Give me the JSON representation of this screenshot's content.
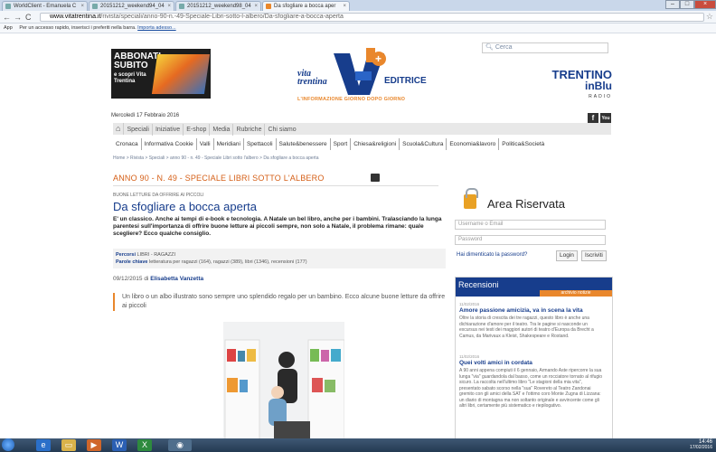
{
  "browser": {
    "tabs": [
      {
        "label": "WorldClient - Emanuela C"
      },
      {
        "label": "20151212_weekend94_04"
      },
      {
        "label": "20151212_weekend98_04"
      },
      {
        "label": "Da sfogliare a bocca aper"
      }
    ],
    "url_domain": "www.vitatrentina.it",
    "url_path": "/rivista/speciali/anno-90-n.-49-Speciale-Libri-sotto-l-albero/Da-sfogliare-a-bocca-aperta",
    "bookmarks_apps": "App",
    "bookmarks_text": "Per un accesso rapido, inserisci i preferiti nella barra.",
    "bookmarks_link": "Importa adesso..."
  },
  "header": {
    "abbonati_title": "ABBONATI SUBITO",
    "abbonati_sub": "e scopri Vita Trentina",
    "date": "Mercoledì 17 Febbraio 2016",
    "logo_vita": "vita trentina",
    "logo_editrice": "EDITRICE",
    "logo_tagline": "L'INFORMAZIONE GIORNO DOPO GIORNO",
    "search_placeholder": "Cerca",
    "radio_trentino": "TRENTINO",
    "radio_inblu": "inBlu",
    "radio_label": "RADIO",
    "social_fb": "f",
    "social_yt": "You"
  },
  "menu_main": [
    "Speciali",
    "Iniziative",
    "E-shop",
    "Media",
    "Rubriche",
    "Chi siamo"
  ],
  "menu_sections": [
    "Cronaca",
    "Informativa Cookie",
    "Valli",
    "Meridiani",
    "Spettacoli",
    "Salute&benessere",
    "Sport",
    "Chiesa&religioni",
    "Scuola&Cultura",
    "Economia&lavoro",
    "Politica&Società"
  ],
  "breadcrumb": "Home  >  Rivista  >  Speciali  >  anno 90 - n. 49 - Speciale Libri sotto l'albero  >  Da sfogliare a bocca aperta",
  "article": {
    "issue": "ANNO 90 - N. 49 - SPECIALE LIBRI SOTTO L'ALBERO",
    "kicker": "BUONE LETTURE DA OFFRIRE AI PICCOLI",
    "title": "Da sfogliare a bocca aperta",
    "lead": "E' un classico. Anche ai tempi di e-book e tecnologia. A Natale un bel libro, anche per i bambini. Tralasciando la lunga parentesi sull'importanza di offrire buone letture ai piccoli sempre, non solo a Natale, il problema rimane: quale scegliere? Ecco qualche consiglio.",
    "percorsi_label": "Percorsi",
    "percorsi_value": "LIBRI - RAGAZZI",
    "parole_label": "Parole chiave",
    "parole_value": "letteratura per ragazzi (164), ragazzi (389), libri (1346), recensioni (177)",
    "byline_date": "09/12/2015 di",
    "byline_author": "Elisabetta Vanzetta",
    "quote": "Un libro o un albo illustrato sono sempre uno splendido regalo per un bambino. Ecco alcune buone letture da offrire ai piccoli"
  },
  "area_riservata": {
    "title": "Area Riservata",
    "username_placeholder": "Username o Email",
    "password_placeholder": "Password",
    "forgot": "Hai dimenticato la password?",
    "login": "Login",
    "iscriviti": "Iscriviti"
  },
  "recensioni": {
    "title": "Recensioni",
    "archive": "archivio notizie",
    "items": [
      {
        "date": "11/02/2016",
        "title": "Amore passione amicizia, va in scena la vita",
        "body": "Oltre la storia di crescita dei tre ragazzi, questo libro è anche una dichiarazione d'amore per il teatro. Tra le pagine si nasconde un excursus nei testi dei maggiori autori di teatro d'Europa da Brecht a Camus, da Marivaux a Kleist, Shakespeare e Rostand."
      },
      {
        "date": "11/02/2016",
        "title": "Quei volti amici in cordata",
        "body": "A 90 anni appena compiuti il 6 gennaio, Armando Aste ripercorre la sua lunga \"via\" guardandola dal basso, come un rocciatore tornato al rifugio sicuro. La raccolta nell'ultimo libro \"Le stagioni della mia vita\", presentato sabato scorso nella \"sua\" Rovereto al Teatro Zandonai gremito con gli amici della SAT e l'ottimo coro Monte Zugna di Lizzana: un diario di montagna ma non soltanto originale e avvincente come gli altri libri, certamente più sistematico e riepilogativo."
      }
    ]
  },
  "taskbar": {
    "time": "14:46",
    "date": "17/02/2016"
  },
  "colors": {
    "brand_blue": "#173d8c",
    "accent_orange": "#e9872c"
  }
}
